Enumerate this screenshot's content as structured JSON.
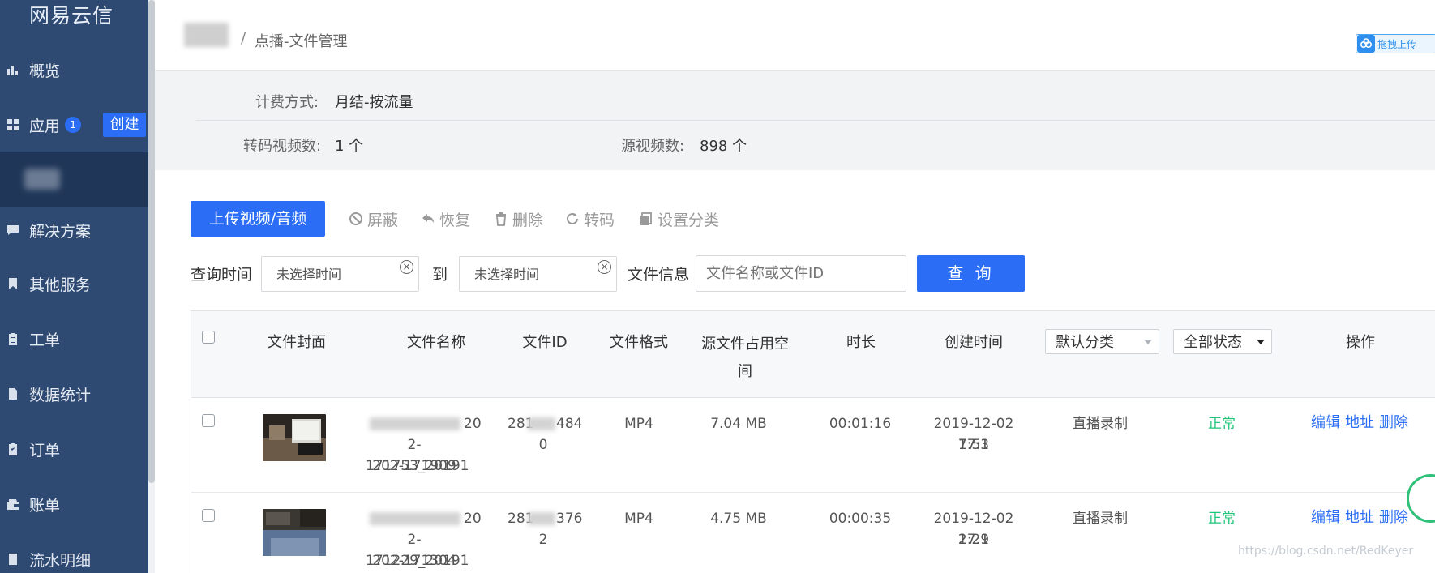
{
  "sidebar": {
    "logo": "网易云信",
    "items": [
      {
        "label": "概览",
        "icon": "bar-chart-icon"
      },
      {
        "label": "应用",
        "icon": "grid-icon",
        "badge": "1",
        "action": "创建"
      },
      {
        "label": "解决方案",
        "icon": "comment-icon"
      },
      {
        "label": "其他服务",
        "icon": "bookmark-icon"
      },
      {
        "label": "工单",
        "icon": "clipboard-icon"
      },
      {
        "label": "数据统计",
        "icon": "document-icon"
      },
      {
        "label": "订单",
        "icon": "order-icon"
      },
      {
        "label": "账单",
        "icon": "wallet-icon"
      },
      {
        "label": "流水明细",
        "icon": "list-icon"
      }
    ]
  },
  "header": {
    "separator": "/",
    "title": "点播-文件管理",
    "drag_upload": "拖拽上传"
  },
  "info": {
    "billing_label": "计费方式:",
    "billing_value": "月结-按流量",
    "transcode_label": "转码视频数:",
    "transcode_value": "1 个",
    "source_label": "源视频数:",
    "source_value": "898 个"
  },
  "toolbar": {
    "upload": "上传视频/音频",
    "block": "屏蔽",
    "restore": "恢复",
    "delete": "删除",
    "transcode": "转码",
    "set_category": "设置分类"
  },
  "query": {
    "time_label": "查询时间",
    "start_placeholder": "未选择时间",
    "to": "到",
    "end_placeholder": "未选择时间",
    "file_label": "文件信息",
    "file_placeholder": "文件名称或文件ID",
    "submit": "查 询",
    "clear_glyph": "×"
  },
  "table": {
    "headers": {
      "cover": "文件封面",
      "name": "文件名称",
      "id": "文件ID",
      "format": "文件格式",
      "size": "源文件占用空间",
      "duration": "时长",
      "created": "创建时间",
      "category_select": "默认分类",
      "status_select": "全部状态",
      "ops": "操作"
    },
    "rows": [
      {
        "name_line1": "20",
        "name_line2": "2-171753_20191",
        "name_line3": "202-171909",
        "id_prefix": "281",
        "id_suffix": "484",
        "id_line2": "0",
        "format": "MP4",
        "size": "7.04 MB",
        "duration": "00:01:16",
        "created_line1": "2019-12-02 17:1",
        "created_line2": "7:53",
        "category": "直播录制",
        "status": "正常",
        "ops": [
          "编辑",
          "地址",
          "删除"
        ]
      },
      {
        "name_line1": "20",
        "name_line2": "2-171229_20191",
        "name_line3": "202-171304",
        "id_prefix": "281",
        "id_suffix": "376",
        "id_line2": "2",
        "format": "MP4",
        "size": "4.75 MB",
        "duration": "00:00:35",
        "created_line1": "2019-12-02 17:1",
        "created_line2": "2:29",
        "category": "直播录制",
        "status": "正常",
        "ops": [
          "编辑",
          "地址",
          "删除"
        ]
      }
    ]
  },
  "watermark": "https://blog.csdn.net/RedKeyer",
  "colors": {
    "sidebar": "#2e4a73",
    "primary": "#2b6ef5",
    "status_ok": "#22c57a"
  }
}
